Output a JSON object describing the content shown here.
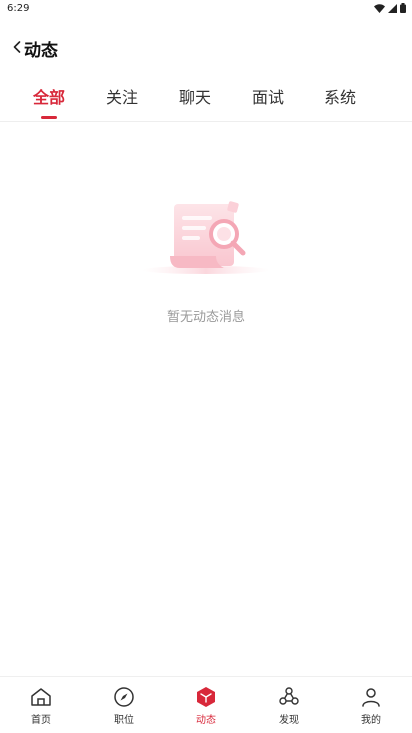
{
  "status_bar": {
    "time": "6:29"
  },
  "header": {
    "title": "动态"
  },
  "tabs": [
    {
      "label": "全部",
      "active": true
    },
    {
      "label": "关注",
      "active": false
    },
    {
      "label": "聊天",
      "active": false
    },
    {
      "label": "面试",
      "active": false
    },
    {
      "label": "系统",
      "active": false
    }
  ],
  "empty_state": {
    "message": "暂无动态消息"
  },
  "bottom_nav": [
    {
      "label": "首页",
      "icon": "home-icon",
      "active": false
    },
    {
      "label": "职位",
      "icon": "compass-icon",
      "active": false
    },
    {
      "label": "动态",
      "icon": "cube-icon",
      "active": true
    },
    {
      "label": "发现",
      "icon": "discover-icon",
      "active": false
    },
    {
      "label": "我的",
      "icon": "user-icon",
      "active": false
    }
  ],
  "colors": {
    "accent": "#d8283a",
    "text": "#333333",
    "muted": "#999999"
  }
}
